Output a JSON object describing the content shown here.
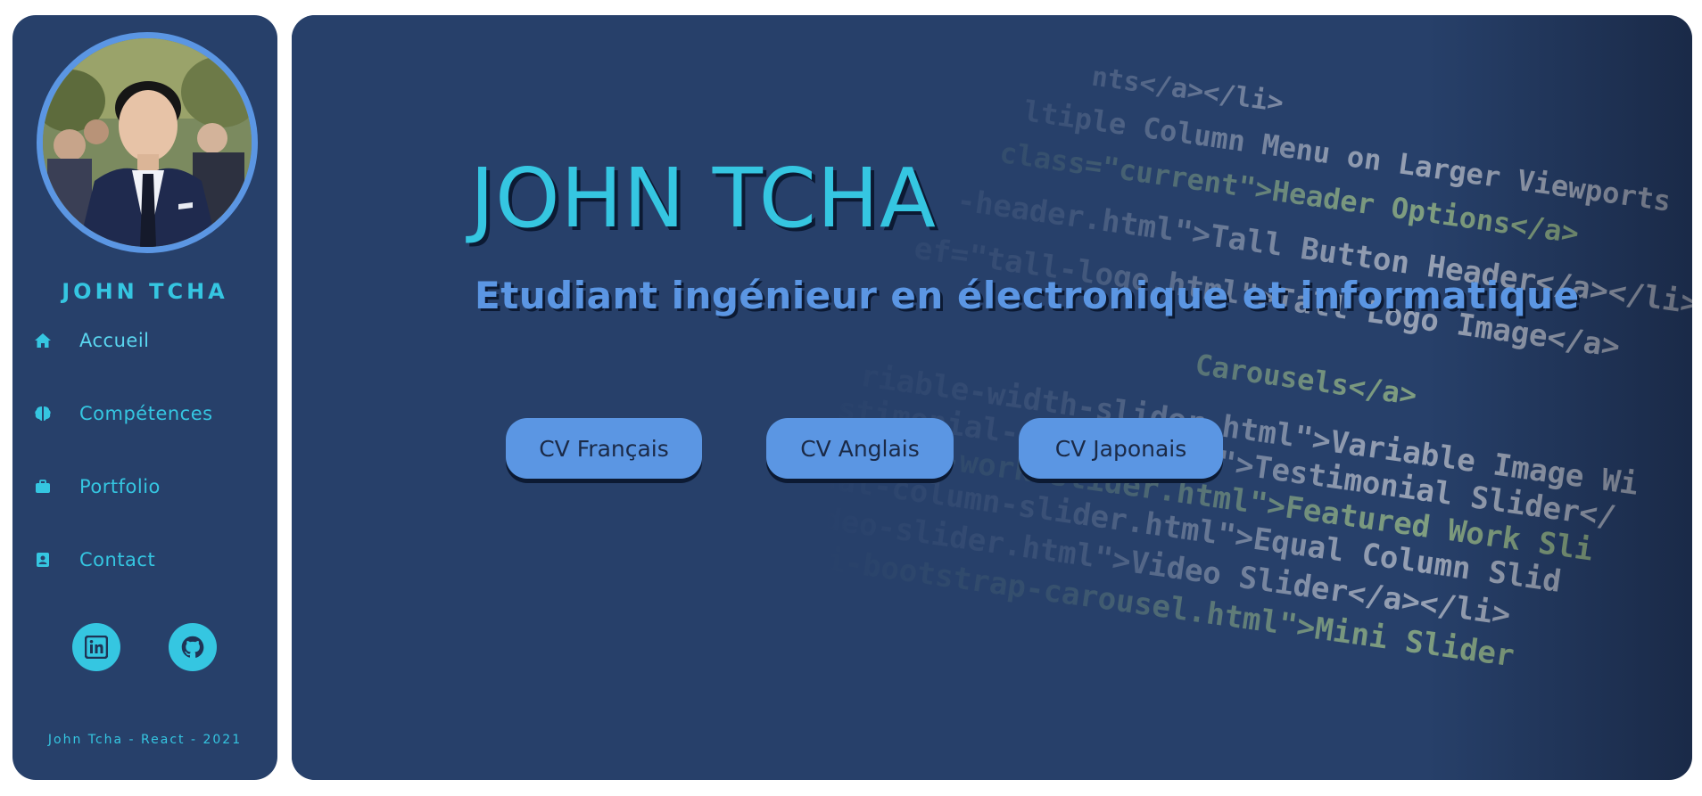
{
  "sidebar": {
    "name": "JOHN TCHA",
    "nav": [
      {
        "label": "Accueil",
        "icon": "home-icon"
      },
      {
        "label": "Compétences",
        "icon": "brain-icon"
      },
      {
        "label": "Portfolio",
        "icon": "briefcase-icon"
      },
      {
        "label": "Contact",
        "icon": "address-book-icon"
      }
    ],
    "social": [
      {
        "icon": "linkedin-icon"
      },
      {
        "icon": "github-icon"
      }
    ],
    "footer": "John Tcha - React - 2021"
  },
  "hero": {
    "title": "JOHN TCHA",
    "subtitle": "Etudiant ingénieur en électronique et informatique",
    "buttons": [
      "CV Français",
      "CV Anglais",
      "CV Japonais"
    ]
  },
  "background_code": {
    "lines": [
      "nts</a></li>",
      "ltiple Column Menu on Larger Viewports",
      "class=\"current\">Header Options</a>",
      "-header.html\">Tall Button Header</a></li>",
      "ef=\"tall-logo.html\">Tall Logo Image</a>",
      "Carousels</a>",
      "riable-width-slider.html\">Variable Image Wi",
      "stimonial-slider.html\">Testimonial Slider</",
      "eatured-work-slider.html\">Featured Work Sli",
      "qual-column-slider.html\">Equal Column Slid",
      "video-slider.html\">Video Slider</a></li>",
      "mini-bootstrap-carousel.html\">Mini Slider"
    ]
  },
  "colors": {
    "panel": "#27406a",
    "accent_cyan": "#35c6e1",
    "accent_blue": "#5b96e3",
    "dark_shadow": "#0c1a33",
    "code_tag": "#e0245e"
  }
}
